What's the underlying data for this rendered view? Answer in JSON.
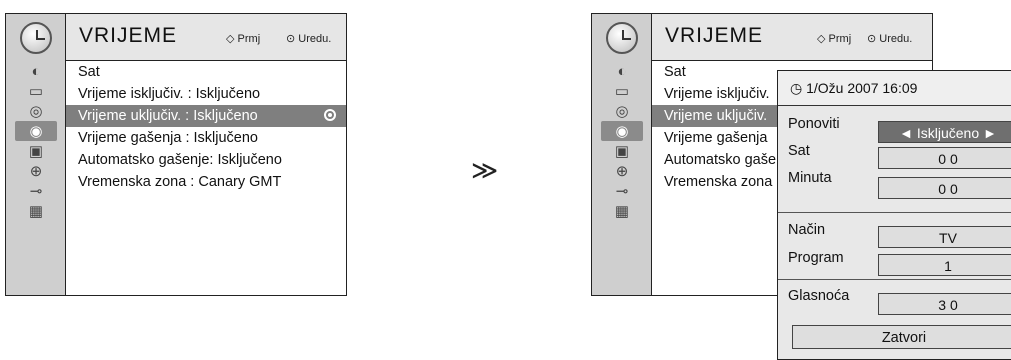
{
  "left": {
    "title": "VRIJEME",
    "hint_move": "Prmj",
    "hint_ok": "Uredu.",
    "menu": [
      "Sat",
      "Vrijeme isključiv.    : Isključeno",
      "Vrijeme uključiv.    : Isključeno",
      "Vrijeme gašenja    : Isključeno",
      "Automatsko gašenje: Isključeno",
      "Vremenska zona : Canary GMT"
    ]
  },
  "right": {
    "title": "VRIJEME",
    "hint_move": "Prmj",
    "hint_ok": "Uredu.",
    "menu": [
      "Sat",
      "Vrijeme isključiv.",
      "Vrijeme uključiv.",
      "Vrijeme gašenja",
      "Automatsko gaše",
      "Vremenska zona :"
    ]
  },
  "arrow": "≫",
  "popup": {
    "datetime": "1/Ožu 2007 16:09",
    "fields": [
      {
        "label": "Ponoviti",
        "value": "◄  Isključeno  ►"
      },
      {
        "label": "Sat",
        "value": "0 0"
      },
      {
        "label": "Minuta",
        "value": "0 0"
      },
      {
        "label": "Način",
        "value": "TV"
      },
      {
        "label": "Program",
        "value": "1"
      },
      {
        "label": "Glasnoća",
        "value": "3 0"
      }
    ],
    "close_label": "Zatvori"
  },
  "icons": [
    "picture-icon",
    "monitor-icon",
    "audio-icon",
    "time-icon",
    "option-icon",
    "lock-icon",
    "input-icon",
    "usb-icon"
  ]
}
